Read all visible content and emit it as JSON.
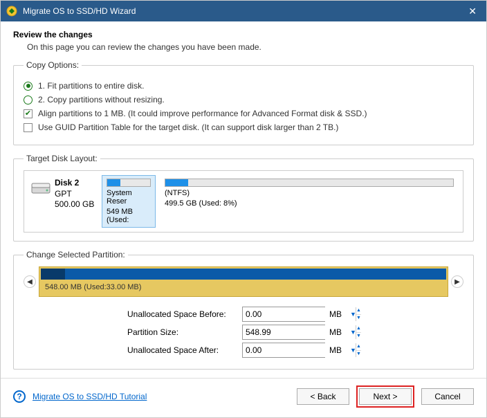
{
  "titlebar": {
    "title": "Migrate OS to SSD/HD Wizard"
  },
  "review": {
    "heading": "Review the changes",
    "sub": "On this page you can review the changes you have been made."
  },
  "copy_options": {
    "legend": "Copy Options:",
    "opt1": "1. Fit partitions to entire disk.",
    "opt2": "2. Copy partitions without resizing.",
    "align_label": "Align partitions to 1 MB.  (It could improve performance for Advanced Format disk & SSD.)",
    "guid_label": "Use GUID Partition Table for the target disk. (It can support disk larger than 2 TB.)"
  },
  "target_layout": {
    "legend": "Target Disk Layout:",
    "disk_name": "Disk 2",
    "disk_type": "GPT",
    "disk_size": "500.00 GB",
    "p1_name": "System Reser",
    "p1_info": "549 MB (Used:",
    "p2_name": "(NTFS)",
    "p2_info": "499.5 GB (Used: 8%)"
  },
  "change_partition": {
    "legend": "Change Selected Partition:",
    "bar_label": "548.00 MB (Used:33.00 MB)",
    "before_label": "Unallocated Space Before:",
    "before_value": "0.00",
    "size_label": "Partition Size:",
    "size_value": "548.99",
    "after_label": "Unallocated Space After:",
    "after_value": "0.00",
    "unit": "MB"
  },
  "footer": {
    "tutorial": "Migrate OS to SSD/HD Tutorial",
    "back": "< Back",
    "next": "Next >",
    "cancel": "Cancel"
  }
}
